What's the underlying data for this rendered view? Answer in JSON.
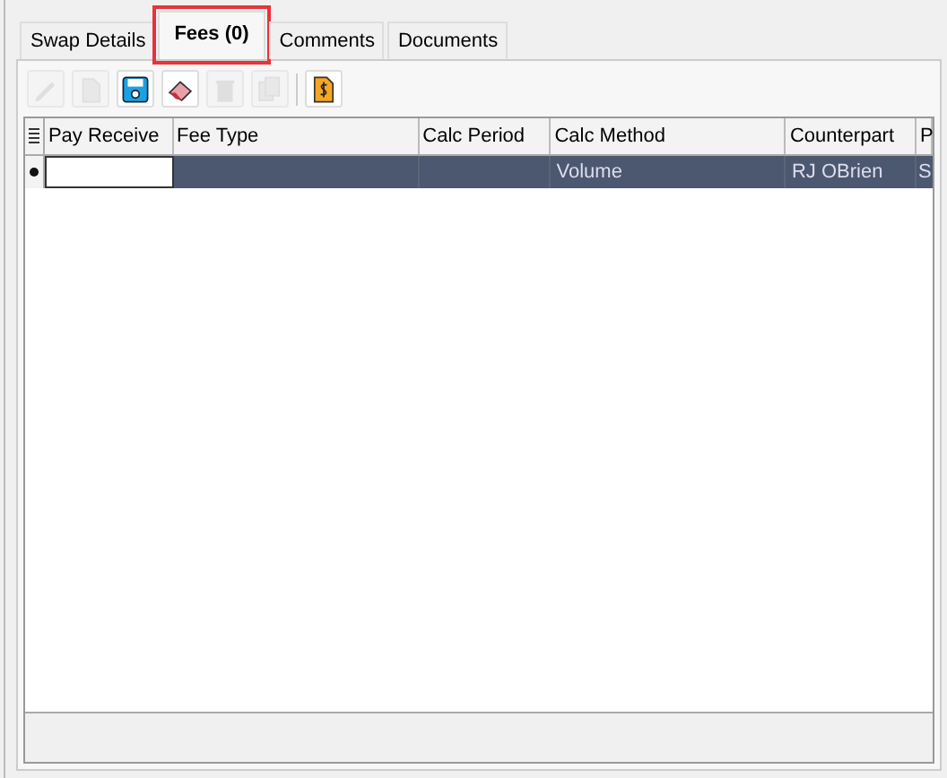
{
  "tabs": [
    {
      "label": "Swap Details",
      "selected": false,
      "highlighted": false
    },
    {
      "label": "Fees (0)",
      "selected": true,
      "highlighted": true
    },
    {
      "label": "Comments",
      "selected": false,
      "highlighted": false
    },
    {
      "label": "Documents",
      "selected": false,
      "highlighted": false
    }
  ],
  "toolbar": [
    {
      "kind": "edit",
      "disabled": true
    },
    {
      "kind": "new",
      "disabled": true
    },
    {
      "kind": "save",
      "disabled": false
    },
    {
      "kind": "clear",
      "disabled": false
    },
    {
      "kind": "delete",
      "disabled": true
    },
    {
      "kind": "copy",
      "disabled": true
    },
    {
      "kind": "separator"
    },
    {
      "kind": "fee",
      "disabled": false
    }
  ],
  "table": {
    "columns": [
      "Pay Receive",
      "Fee Type",
      "Calc Period",
      "Calc Method",
      "Counterpart",
      "P"
    ],
    "rows": [
      {
        "selected": true,
        "cells": [
          "",
          "",
          "",
          "Volume",
          "RJ OBrien",
          "S"
        ]
      }
    ]
  }
}
